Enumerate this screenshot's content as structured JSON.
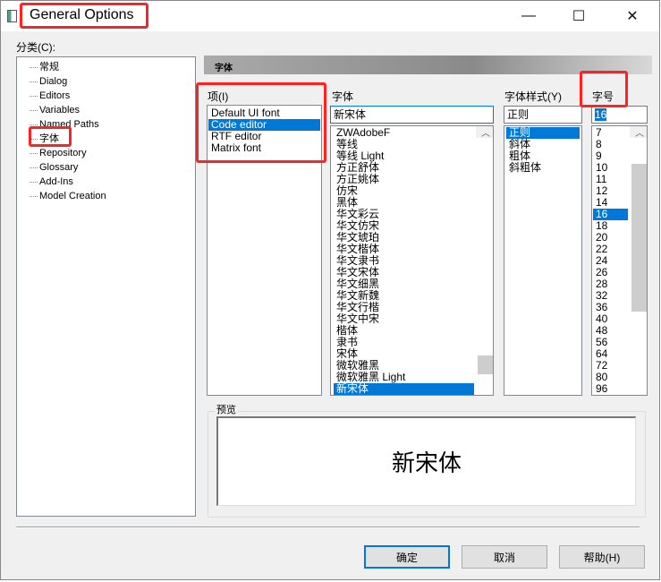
{
  "window": {
    "title": "General Options",
    "minimize": "—",
    "maximize": "☐",
    "close": "✕"
  },
  "category": {
    "label": "分类(C):",
    "items": [
      "常规",
      "Dialog",
      "Editors",
      "Variables",
      "Named Paths",
      "字体",
      "Repository",
      "Glossary",
      "Add-Ins",
      "Model Creation"
    ],
    "selected": "字体"
  },
  "section_header": "字体",
  "items_list": {
    "label": "项(I)",
    "items": [
      "Default UI font",
      "Code editor",
      "RTF editor",
      "Matrix font"
    ],
    "selected": "Code editor"
  },
  "font": {
    "label": "字体",
    "value": "新宋体",
    "items": [
      "ZWAdobeF",
      "等线",
      "等线 Light",
      "方正舒体",
      "方正姚体",
      "仿宋",
      "黑体",
      "华文彩云",
      "华文仿宋",
      "华文琥珀",
      "华文楷体",
      "华文隶书",
      "华文宋体",
      "华文细黑",
      "华文新魏",
      "华文行楷",
      "华文中宋",
      "楷体",
      "隶书",
      "宋体",
      "微软雅黑",
      "微软雅黑 Light",
      "新宋体"
    ],
    "selected": "新宋体"
  },
  "style": {
    "label": "字体样式(Y)",
    "value": "正则",
    "items": [
      "正则",
      "斜体",
      "粗体",
      "斜粗体"
    ],
    "selected": "正则"
  },
  "size": {
    "label": "字号",
    "value": "16",
    "items": [
      "7",
      "8",
      "9",
      "10",
      "11",
      "12",
      "14",
      "16",
      "18",
      "20",
      "22",
      "24",
      "26",
      "28",
      "32",
      "36",
      "40",
      "48",
      "56",
      "64",
      "72",
      "80",
      "96"
    ],
    "selected": "16"
  },
  "preview": {
    "label": "预览",
    "text": "新宋体"
  },
  "buttons": {
    "ok": "确定",
    "cancel": "取消",
    "help": "帮助(H)"
  },
  "colors": {
    "accent": "#0078d7",
    "annotation": "#ff2222"
  }
}
